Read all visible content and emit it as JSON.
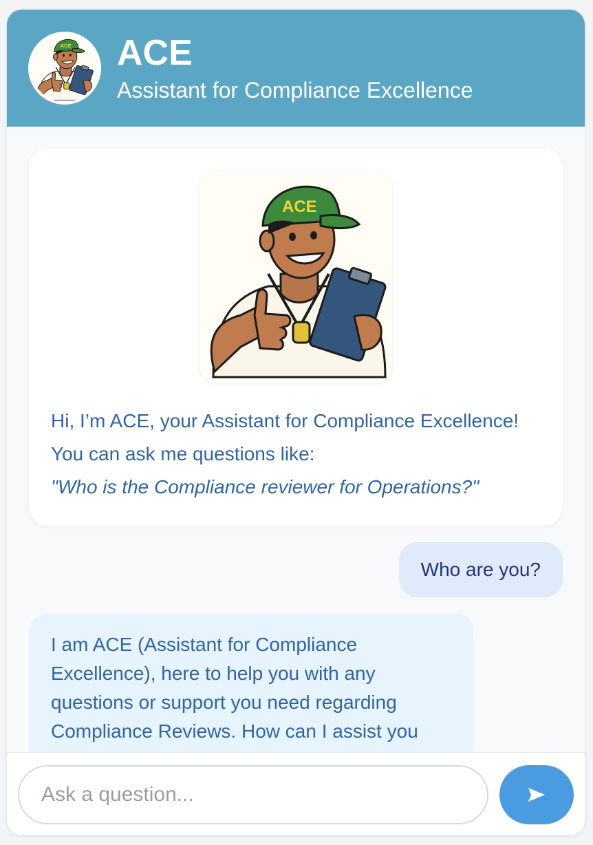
{
  "header": {
    "title": "ACE",
    "subtitle": "Assistant for Compliance Excellence",
    "avatar_icon": "ace-mascot-icon"
  },
  "welcome": {
    "mascot_icon": "ace-mascot-icon",
    "hat_text": "ACE",
    "line1": "Hi, I’m ACE, your Assistant for Compliance Excellence! You can ask me questions like:",
    "example": "\"Who is the Compliance reviewer for Operations?\""
  },
  "messages": [
    {
      "role": "user",
      "text": "Who are you?"
    },
    {
      "role": "assistant",
      "text": "I am ACE (Assistant for Compliance Excellence), here to help you with any questions or support you need regarding Compliance Reviews. How can I assist you today?"
    }
  ],
  "input": {
    "placeholder": "Ask a question...",
    "value": ""
  },
  "send_button": {
    "icon": "send-arrow-icon"
  },
  "colors": {
    "header_bg": "#5ba6c5",
    "user_bubble_bg": "#e1eafa",
    "bot_bubble_bg": "#e7f4fd",
    "text_blue": "#2f66a0",
    "send_button_bg": "#4a9be0"
  }
}
